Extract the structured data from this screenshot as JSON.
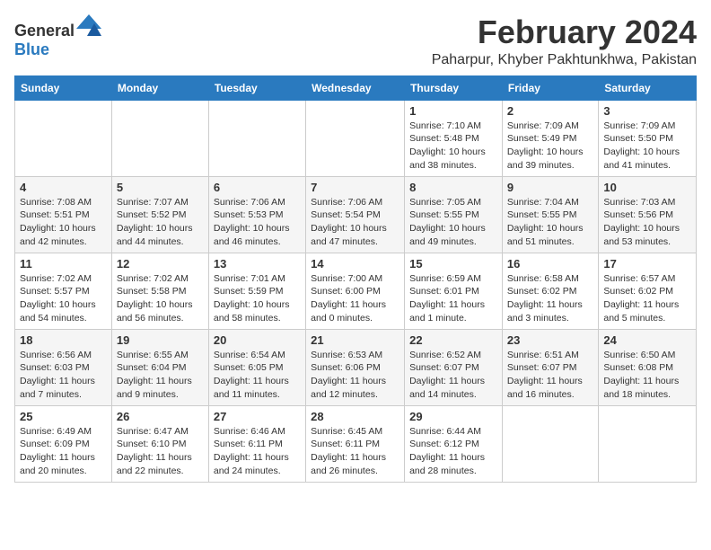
{
  "header": {
    "logo_general": "General",
    "logo_blue": "Blue",
    "month_year": "February 2024",
    "location": "Paharpur, Khyber Pakhtunkhwa, Pakistan"
  },
  "weekdays": [
    "Sunday",
    "Monday",
    "Tuesday",
    "Wednesday",
    "Thursday",
    "Friday",
    "Saturday"
  ],
  "weeks": [
    [
      {
        "day": "",
        "text": ""
      },
      {
        "day": "",
        "text": ""
      },
      {
        "day": "",
        "text": ""
      },
      {
        "day": "",
        "text": ""
      },
      {
        "day": "1",
        "text": "Sunrise: 7:10 AM\nSunset: 5:48 PM\nDaylight: 10 hours\nand 38 minutes."
      },
      {
        "day": "2",
        "text": "Sunrise: 7:09 AM\nSunset: 5:49 PM\nDaylight: 10 hours\nand 39 minutes."
      },
      {
        "day": "3",
        "text": "Sunrise: 7:09 AM\nSunset: 5:50 PM\nDaylight: 10 hours\nand 41 minutes."
      }
    ],
    [
      {
        "day": "4",
        "text": "Sunrise: 7:08 AM\nSunset: 5:51 PM\nDaylight: 10 hours\nand 42 minutes."
      },
      {
        "day": "5",
        "text": "Sunrise: 7:07 AM\nSunset: 5:52 PM\nDaylight: 10 hours\nand 44 minutes."
      },
      {
        "day": "6",
        "text": "Sunrise: 7:06 AM\nSunset: 5:53 PM\nDaylight: 10 hours\nand 46 minutes."
      },
      {
        "day": "7",
        "text": "Sunrise: 7:06 AM\nSunset: 5:54 PM\nDaylight: 10 hours\nand 47 minutes."
      },
      {
        "day": "8",
        "text": "Sunrise: 7:05 AM\nSunset: 5:55 PM\nDaylight: 10 hours\nand 49 minutes."
      },
      {
        "day": "9",
        "text": "Sunrise: 7:04 AM\nSunset: 5:55 PM\nDaylight: 10 hours\nand 51 minutes."
      },
      {
        "day": "10",
        "text": "Sunrise: 7:03 AM\nSunset: 5:56 PM\nDaylight: 10 hours\nand 53 minutes."
      }
    ],
    [
      {
        "day": "11",
        "text": "Sunrise: 7:02 AM\nSunset: 5:57 PM\nDaylight: 10 hours\nand 54 minutes."
      },
      {
        "day": "12",
        "text": "Sunrise: 7:02 AM\nSunset: 5:58 PM\nDaylight: 10 hours\nand 56 minutes."
      },
      {
        "day": "13",
        "text": "Sunrise: 7:01 AM\nSunset: 5:59 PM\nDaylight: 10 hours\nand 58 minutes."
      },
      {
        "day": "14",
        "text": "Sunrise: 7:00 AM\nSunset: 6:00 PM\nDaylight: 11 hours\nand 0 minutes."
      },
      {
        "day": "15",
        "text": "Sunrise: 6:59 AM\nSunset: 6:01 PM\nDaylight: 11 hours\nand 1 minute."
      },
      {
        "day": "16",
        "text": "Sunrise: 6:58 AM\nSunset: 6:02 PM\nDaylight: 11 hours\nand 3 minutes."
      },
      {
        "day": "17",
        "text": "Sunrise: 6:57 AM\nSunset: 6:02 PM\nDaylight: 11 hours\nand 5 minutes."
      }
    ],
    [
      {
        "day": "18",
        "text": "Sunrise: 6:56 AM\nSunset: 6:03 PM\nDaylight: 11 hours\nand 7 minutes."
      },
      {
        "day": "19",
        "text": "Sunrise: 6:55 AM\nSunset: 6:04 PM\nDaylight: 11 hours\nand 9 minutes."
      },
      {
        "day": "20",
        "text": "Sunrise: 6:54 AM\nSunset: 6:05 PM\nDaylight: 11 hours\nand 11 minutes."
      },
      {
        "day": "21",
        "text": "Sunrise: 6:53 AM\nSunset: 6:06 PM\nDaylight: 11 hours\nand 12 minutes."
      },
      {
        "day": "22",
        "text": "Sunrise: 6:52 AM\nSunset: 6:07 PM\nDaylight: 11 hours\nand 14 minutes."
      },
      {
        "day": "23",
        "text": "Sunrise: 6:51 AM\nSunset: 6:07 PM\nDaylight: 11 hours\nand 16 minutes."
      },
      {
        "day": "24",
        "text": "Sunrise: 6:50 AM\nSunset: 6:08 PM\nDaylight: 11 hours\nand 18 minutes."
      }
    ],
    [
      {
        "day": "25",
        "text": "Sunrise: 6:49 AM\nSunset: 6:09 PM\nDaylight: 11 hours\nand 20 minutes."
      },
      {
        "day": "26",
        "text": "Sunrise: 6:47 AM\nSunset: 6:10 PM\nDaylight: 11 hours\nand 22 minutes."
      },
      {
        "day": "27",
        "text": "Sunrise: 6:46 AM\nSunset: 6:11 PM\nDaylight: 11 hours\nand 24 minutes."
      },
      {
        "day": "28",
        "text": "Sunrise: 6:45 AM\nSunset: 6:11 PM\nDaylight: 11 hours\nand 26 minutes."
      },
      {
        "day": "29",
        "text": "Sunrise: 6:44 AM\nSunset: 6:12 PM\nDaylight: 11 hours\nand 28 minutes."
      },
      {
        "day": "",
        "text": ""
      },
      {
        "day": "",
        "text": ""
      }
    ]
  ]
}
